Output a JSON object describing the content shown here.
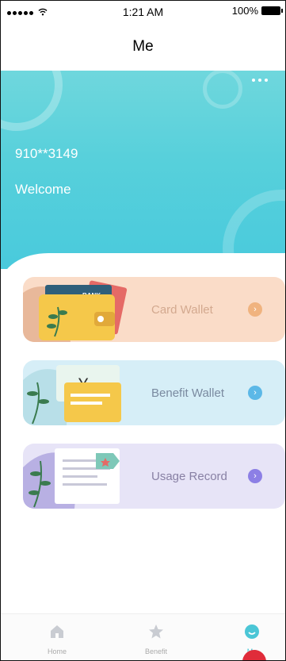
{
  "status_bar": {
    "time": "1:21 AM",
    "battery": "100%"
  },
  "nav": {
    "title": "Me"
  },
  "profile": {
    "phone": "910**3149",
    "greeting": "Welcome"
  },
  "cards": [
    {
      "label": "Card Wallet",
      "illustration_text": "BANK",
      "color": "#fadcc8",
      "arrow_color": "#f0b37f"
    },
    {
      "label": "Benefit Wallet",
      "illustration_text": "¥",
      "color": "#d6eef7",
      "arrow_color": "#5cb8e7"
    },
    {
      "label": "Usage Record",
      "color": "#e7e4f7",
      "arrow_color": "#8c7fe5"
    }
  ],
  "tabs": [
    {
      "label": "Home",
      "icon": "home-icon"
    },
    {
      "label": "Benefit",
      "icon": "star-icon"
    },
    {
      "label": "Me",
      "icon": "me-icon",
      "active": true
    }
  ],
  "colors": {
    "accent": "#4bc6d6",
    "header": "#57d0db",
    "badge": "#e02c3a"
  }
}
